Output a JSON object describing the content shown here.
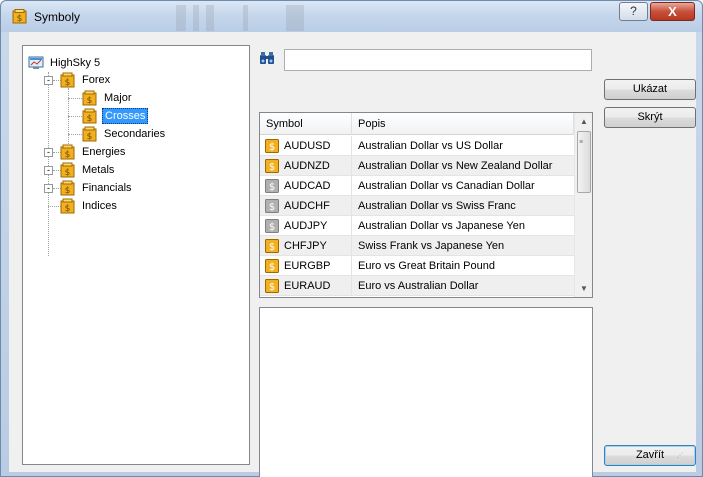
{
  "window": {
    "title": "Symboly",
    "help_label": "?",
    "close_label": "X"
  },
  "tree": {
    "root": "HighSky 5",
    "forex": "Forex",
    "forex_children": [
      "Major",
      "Crosses",
      "Secondaries"
    ],
    "selected": "Crosses",
    "others": [
      "Energies",
      "Metals",
      "Financials",
      "Indices"
    ],
    "expander_collapsed": "-",
    "expander_expanded": "-"
  },
  "search": {
    "value": "",
    "placeholder": ""
  },
  "table": {
    "columns": [
      "Symbol",
      "Popis"
    ],
    "rows": [
      {
        "symbol": "AUDUSD",
        "popis": "Australian Dollar vs US Dollar",
        "icon": "gold"
      },
      {
        "symbol": "AUDNZD",
        "popis": "Australian Dollar vs New Zealand Dollar",
        "icon": "gold"
      },
      {
        "symbol": "AUDCAD",
        "popis": "Australian Dollar vs Canadian Dollar",
        "icon": "gray"
      },
      {
        "symbol": "AUDCHF",
        "popis": "Australian Dollar vs Swiss Franc",
        "icon": "gray"
      },
      {
        "symbol": "AUDJPY",
        "popis": "Australian Dollar vs Japanese Yen",
        "icon": "gray"
      },
      {
        "symbol": "CHFJPY",
        "popis": "Swiss Frank vs Japanese Yen",
        "icon": "gold"
      },
      {
        "symbol": "EURGBP",
        "popis": "Euro vs Great Britain Pound",
        "icon": "gold"
      },
      {
        "symbol": "EURAUD",
        "popis": "Euro vs Australian Dollar",
        "icon": "gold"
      }
    ]
  },
  "buttons": {
    "show": "Ukázat",
    "hide": "Skrýt",
    "close": "Zavřít"
  },
  "colors": {
    "selection": "#3399ff",
    "icon_gold": "#f0b020",
    "icon_gray": "#b0b0b0",
    "title_bar": "#c6d7ec"
  }
}
